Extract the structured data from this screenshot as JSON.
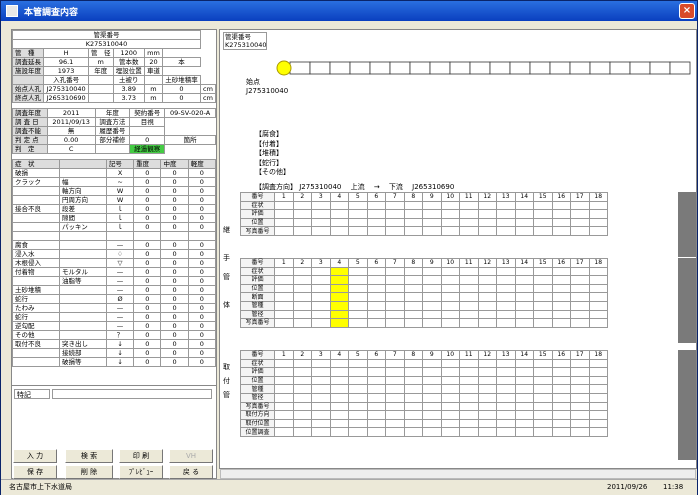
{
  "window": {
    "title": "本管調査内容",
    "close": "×"
  },
  "left_table": {
    "pipe_no_label": "管渠番号",
    "pipe_no": "K275310040",
    "rows": [
      [
        "管　種",
        "H",
        "管　径",
        "1200",
        "mm"
      ],
      [
        "調査延長",
        "96.1",
        "m",
        "管本数",
        "20",
        "本"
      ],
      [
        "施設年度",
        "1973",
        "年度",
        "埋設位置",
        "車道"
      ],
      [
        "",
        "入孔番号",
        "",
        "土被り",
        "",
        "土砂堆積率"
      ],
      [
        "始点人孔",
        "J275310040",
        "",
        "3.89",
        "m",
        "0",
        "cm"
      ],
      [
        "終点人孔",
        "J265310690",
        "",
        "3.73",
        "m",
        "0",
        "cm"
      ]
    ],
    "rows2": [
      [
        "調査年度",
        "2011",
        "年度",
        "契約番号",
        "09-SV-020-A"
      ],
      [
        "調 査 日",
        "2011/09/13",
        "調査方法",
        "目視"
      ],
      [
        "調査不能",
        "無",
        "履歴番号",
        ""
      ],
      [
        "判 定 点",
        "0.00",
        "部分補修",
        "0",
        "箇所"
      ],
      [
        "判　定",
        "C",
        "",
        "経過観察"
      ]
    ],
    "cond_header": [
      "症　状",
      "",
      "記号",
      "重度",
      "中度",
      "軽度"
    ],
    "cond_rows": [
      [
        "破損",
        "",
        "X",
        "0",
        "0",
        "0"
      ],
      [
        "クラック",
        "幅",
        "~",
        "0",
        "0",
        "0"
      ],
      [
        "",
        "軸方向",
        "W",
        "0",
        "0",
        "0"
      ],
      [
        "",
        "円周方向",
        "W",
        "0",
        "0",
        "0"
      ],
      [
        "接合不良",
        "段差",
        "ｌ",
        "0",
        "0",
        "0"
      ],
      [
        "",
        "隙間",
        "ｌ",
        "0",
        "0",
        "0"
      ],
      [
        "",
        "パッキン",
        "ｌ",
        "0",
        "0",
        "0"
      ],
      [
        "",
        "",
        "",
        "",
        "",
        ""
      ],
      [
        "腐食",
        "",
        "—",
        "0",
        "0",
        "0"
      ],
      [
        "浸入水",
        "",
        "♢",
        "0",
        "0",
        "0"
      ],
      [
        "木根侵入",
        "",
        "▽",
        "0",
        "0",
        "0"
      ],
      [
        "付着物",
        "モルタル",
        "—",
        "0",
        "0",
        "0"
      ],
      [
        "",
        "油脂等",
        "—",
        "0",
        "0",
        "0"
      ],
      [
        "土砂堆積",
        "",
        "—",
        "0",
        "0",
        "0"
      ],
      [
        "蛇行",
        "",
        "Ø",
        "0",
        "0",
        "0"
      ],
      [
        "たわみ",
        "",
        "—",
        "0",
        "0",
        "0"
      ],
      [
        "蛇行",
        "",
        "—",
        "0",
        "0",
        "0"
      ],
      [
        "逆勾配",
        "",
        "—",
        "0",
        "0",
        "0"
      ],
      [
        "その他",
        "",
        "？",
        "0",
        "0",
        "0"
      ],
      [
        "取付不良",
        "突き出し",
        "↓",
        "0",
        "0",
        "0"
      ],
      [
        "",
        "接続部",
        "↓",
        "0",
        "0",
        "0"
      ],
      [
        "",
        "破損等",
        "↓",
        "0",
        "0",
        "0"
      ]
    ],
    "notes_label": "特記"
  },
  "buttons": {
    "input": "入 力",
    "search": "検 索",
    "print": "印 刷",
    "vh": "VH",
    "save": "保 存",
    "delete": "削 除",
    "preview": "ﾌﾟﾚﾋﾞｭｰ",
    "back": "戻 る"
  },
  "diagram": {
    "pipe_label": "管渠番号",
    "pipe_no": "K275310040",
    "start_label": "始点",
    "start_id": "J275310040",
    "notes": [
      "【腐食】",
      "【付着】",
      "【堆積】",
      "【蛇行】",
      "【その他】"
    ],
    "direction": "【調査方向】 J275310040 　上流 　→ 　下流 　J265310690"
  },
  "sections": {
    "joint": {
      "label": "継手",
      "rows": [
        "番号",
        "症状",
        "評価",
        "位置",
        "写真番号"
      ],
      "first_col_extra": "管口"
    },
    "pipe": {
      "label": "管体",
      "rows": [
        "番号",
        "症状",
        "評価",
        "位置",
        "断面",
        "管種",
        "管径",
        "写真番号"
      ]
    },
    "lateral": {
      "label": "取付管",
      "rows": [
        "番号",
        "症状",
        "評価",
        "位置",
        "管種",
        "管径",
        "写真番号",
        "取付方向",
        "取付位置",
        "位置調査"
      ]
    }
  },
  "cols": [
    "1",
    "2",
    "3",
    "4",
    "5",
    "6",
    "7",
    "8",
    "9",
    "10",
    "11",
    "12",
    "13",
    "14",
    "15",
    "16",
    "17",
    "18"
  ],
  "status": {
    "left": "名古屋市上下水道局",
    "date": "2011/09/26",
    "time": "11:38"
  }
}
